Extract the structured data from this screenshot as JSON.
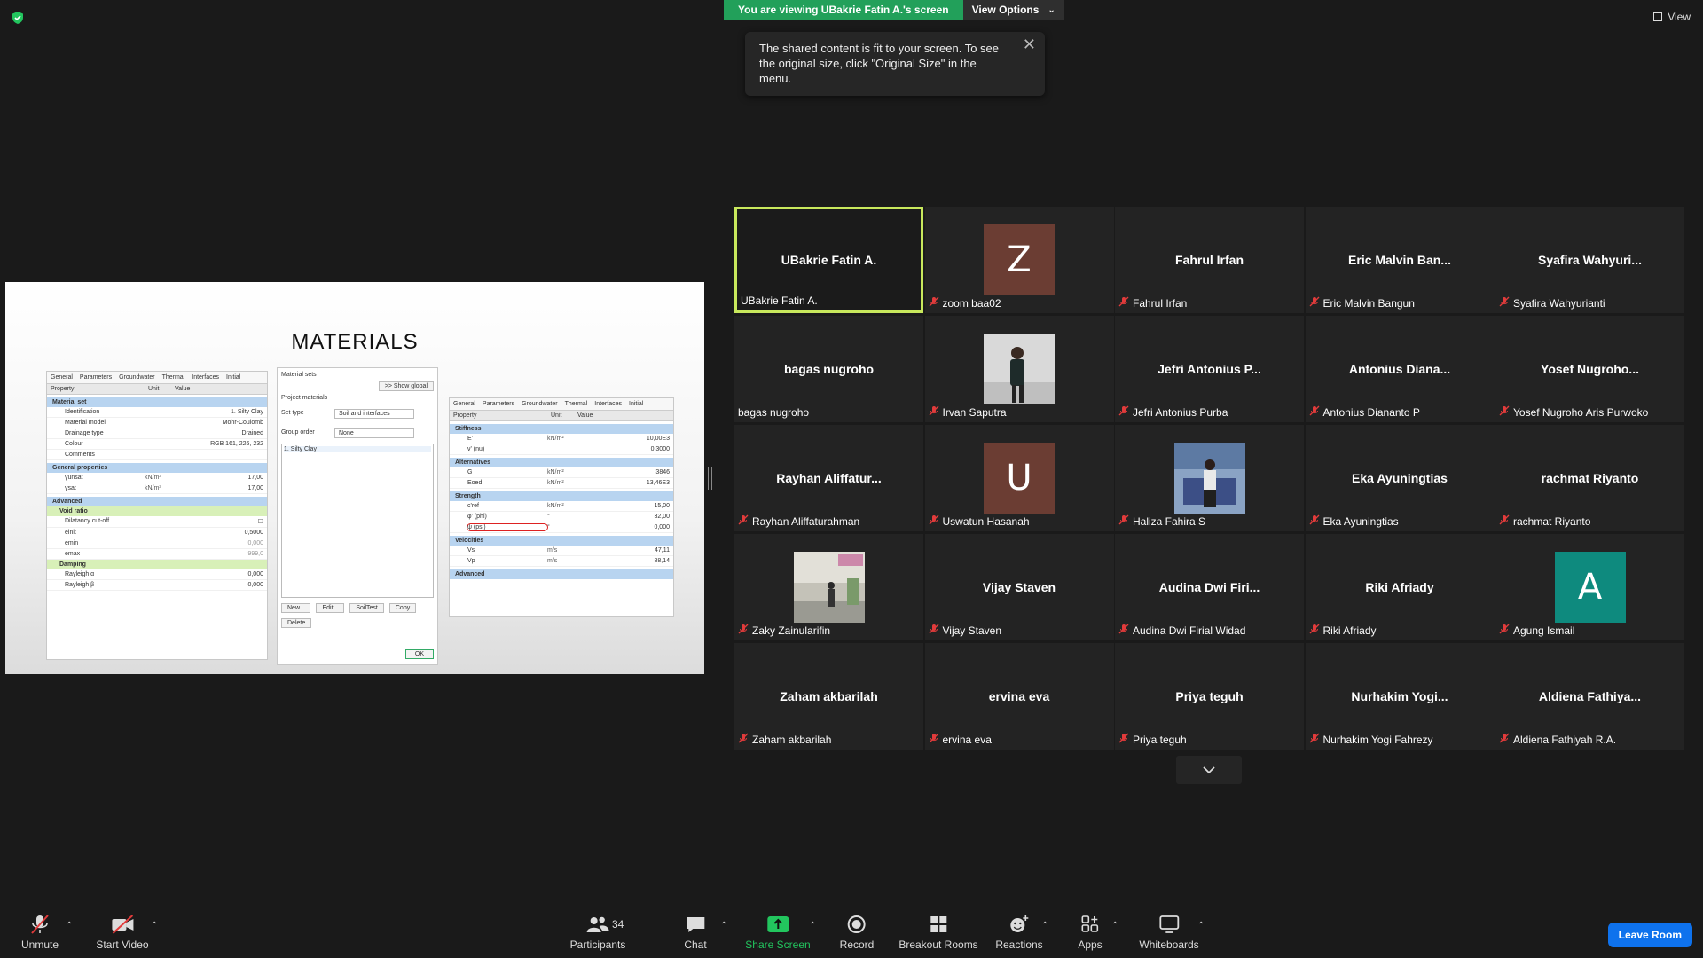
{
  "banner": {
    "viewing": "You are viewing UBakrie Fatin A.'s screen",
    "view_options": "View Options",
    "view": "View"
  },
  "notice": {
    "text": "The shared content is fit to your screen. To see the original size, click \"Original Size\" in the menu."
  },
  "slide": {
    "title": "MATERIALS",
    "left_panel": {
      "tabs": [
        "General",
        "Parameters",
        "Groundwater",
        "Thermal",
        "Interfaces",
        "Initial"
      ],
      "headers": [
        "Property",
        "Unit",
        "Value"
      ],
      "material_set_label": "Material set",
      "rows_material": [
        {
          "k": "Identification",
          "u": "",
          "v": "1. Silty Clay"
        },
        {
          "k": "Material model",
          "u": "",
          "v": "Mohr-Coulomb"
        },
        {
          "k": "Drainage type",
          "u": "",
          "v": "Drained"
        },
        {
          "k": "Colour",
          "u": "",
          "v": "RGB 161, 226, 232"
        },
        {
          "k": "Comments",
          "u": "",
          "v": ""
        }
      ],
      "general_label": "General properties",
      "rows_general": [
        {
          "k": "γunsat",
          "u": "kN/m³",
          "v": "17,00"
        },
        {
          "k": "γsat",
          "u": "kN/m³",
          "v": "17,00"
        }
      ],
      "advanced_label": "Advanced",
      "void_label": "Void ratio",
      "rows_void": [
        {
          "k": "Dilatancy cut-off",
          "u": "",
          "v": ""
        },
        {
          "k": "einit",
          "u": "",
          "v": "0,5000"
        },
        {
          "k": "emin",
          "u": "",
          "v": "0,000"
        },
        {
          "k": "emax",
          "u": "",
          "v": "999,0"
        }
      ],
      "damping_label": "Damping",
      "rows_damping": [
        {
          "k": "Rayleigh α",
          "u": "",
          "v": "0,000"
        },
        {
          "k": "Rayleigh β",
          "u": "",
          "v": "0,000"
        }
      ]
    },
    "mid_panel": {
      "title": "Material sets",
      "show_global": ">> Show global",
      "project_materials": "Project materials",
      "set_type_label": "Set type",
      "set_type_value": "Soil and interfaces",
      "group_order_label": "Group order",
      "group_order_value": "None",
      "list_item": "1. Silty Clay",
      "buttons": [
        "New...",
        "Edit...",
        "SoilTest",
        "Copy",
        "Delete"
      ],
      "ok": "OK"
    },
    "right_panel": {
      "tabs": [
        "General",
        "Parameters",
        "Groundwater",
        "Thermal",
        "Interfaces",
        "Initial"
      ],
      "headers": [
        "Property",
        "Unit",
        "Value"
      ],
      "stiffness_label": "Stiffness",
      "rows_stiffness": [
        {
          "k": "E'",
          "u": "kN/m²",
          "v": "10,00E3"
        },
        {
          "k": "ν' (nu)",
          "u": "",
          "v": "0,3000"
        }
      ],
      "alternatives_label": "Alternatives",
      "rows_alt": [
        {
          "k": "G",
          "u": "kN/m²",
          "v": "3846"
        },
        {
          "k": "Eoed",
          "u": "kN/m²",
          "v": "13,46E3"
        }
      ],
      "strength_label": "Strength",
      "rows_strength": [
        {
          "k": "c'ref",
          "u": "kN/m²",
          "v": "15,00"
        },
        {
          "k": "φ' (phi)",
          "u": "°",
          "v": "32,00"
        },
        {
          "k": "ψ (psi)",
          "u": "°",
          "v": "0,000"
        }
      ],
      "velocities_label": "Velocities",
      "rows_vel": [
        {
          "k": "Vs",
          "u": "m/s",
          "v": "47,11"
        },
        {
          "k": "Vp",
          "u": "m/s",
          "v": "88,14"
        }
      ],
      "advanced_label": "Advanced"
    }
  },
  "participants_grid": [
    {
      "center": "UBakrie Fatin A.",
      "label": "UBakrie Fatin A.",
      "muted": false,
      "active": true
    },
    {
      "center": "",
      "label": "zoom baa02",
      "muted": true,
      "avatar": "Z",
      "avatar_color": "#6b3d33"
    },
    {
      "center": "Fahrul Irfan",
      "label": "Fahrul Irfan",
      "muted": true
    },
    {
      "center": "Eric  Malvin  Ban...",
      "label": "Eric Malvin Bangun",
      "muted": true
    },
    {
      "center": "Syafira  Wahyuri...",
      "label": "Syafira Wahyurianti",
      "muted": true
    },
    {
      "center": "bagas nugroho",
      "label": "bagas nugroho",
      "muted": false
    },
    {
      "center": "",
      "label": "Irvan Saputra",
      "muted": true,
      "photo": "person"
    },
    {
      "center": "Jefri  Antonius  P...",
      "label": "Jefri Antonius Purba",
      "muted": true
    },
    {
      "center": "Antonius  Diana...",
      "label": "Antonius Diananto P",
      "muted": true
    },
    {
      "center": "Yosef  Nugroho...",
      "label": "Yosef Nugroho Aris Purwoko",
      "muted": true
    },
    {
      "center": "Rayhan  Aliffatur...",
      "label": "Rayhan Aliffaturahman",
      "muted": true
    },
    {
      "center": "",
      "label": "Uswatun Hasanah",
      "muted": true,
      "avatar": "U",
      "avatar_color": "#6b3d33"
    },
    {
      "center": "",
      "label": "Haliza Fahira S",
      "muted": true,
      "photo": "room"
    },
    {
      "center": "Eka Ayuningtias",
      "label": "Eka Ayuningtias",
      "muted": true
    },
    {
      "center": "rachmat Riyanto",
      "label": "rachmat Riyanto",
      "muted": true
    },
    {
      "center": "",
      "label": "Zaky Zainularifin",
      "muted": true,
      "photo": "street"
    },
    {
      "center": "Vijay Staven",
      "label": "Vijay Staven",
      "muted": true
    },
    {
      "center": "Audina  Dwi  Firi...",
      "label": "Audina Dwi Firial Widad",
      "muted": true
    },
    {
      "center": "Riki Afriady",
      "label": "Riki Afriady",
      "muted": true
    },
    {
      "center": "",
      "label": "Agung Ismail",
      "muted": true,
      "avatar": "A",
      "avatar_color": "#0e8a7e"
    },
    {
      "center": "Zaham akbarilah",
      "label": "Zaham akbarilah",
      "muted": true
    },
    {
      "center": "ervina eva",
      "label": "ervina eva",
      "muted": true
    },
    {
      "center": "Priya teguh",
      "label": "Priya teguh",
      "muted": true
    },
    {
      "center": "Nurhakim  Yogi...",
      "label": "Nurhakim Yogi Fahrezy",
      "muted": true
    },
    {
      "center": "Aldiena  Fathiya...",
      "label": "Aldiena Fathiyah R.A.",
      "muted": true
    }
  ],
  "toolbar": {
    "unmute": "Unmute",
    "start_video": "Start Video",
    "participants": "Participants",
    "participants_count": "34",
    "chat": "Chat",
    "share_screen": "Share Screen",
    "record": "Record",
    "breakout_rooms": "Breakout Rooms",
    "reactions": "Reactions",
    "apps": "Apps",
    "whiteboards": "Whiteboards",
    "leave_room": "Leave Room"
  },
  "colors": {
    "banner_green": "#22a05a",
    "active_tile_border": "#c8e85c",
    "share_green": "#22c55e",
    "leave_blue": "#0e72ed",
    "mute_red": "#e23b3b"
  }
}
